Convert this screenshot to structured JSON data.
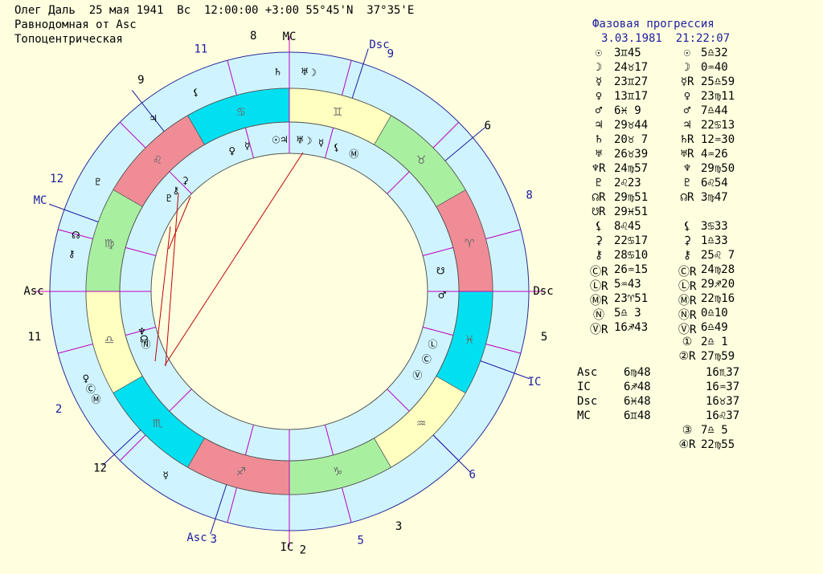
{
  "header": {
    "line1": "Олег Даль  25 мая 1941  Вс  12:00:00 +3:00 55°45'N  37°35'E",
    "line2": "Равнодомная от Asc",
    "line3": "Топоцентрическая"
  },
  "panel": {
    "title": "Фазовая прогрессия",
    "date": "3.03.1981  21:22:07",
    "rows": [
      {
        "s1": "☉",
        "v1": "3♊45",
        "s2": "☉",
        "v2": "5♎32"
      },
      {
        "s1": "☽",
        "v1": "24♉17",
        "s2": "☽",
        "v2": "0♒40"
      },
      {
        "s1": "☿",
        "v1": "23♊27",
        "s2": "☿R",
        "v2": "25♎59"
      },
      {
        "s1": "♀",
        "v1": "13♊17",
        "s2": "♀",
        "v2": "23♍11"
      },
      {
        "s1": "♂",
        "v1": "6♓ 9",
        "s2": "♂",
        "v2": "7♎44"
      },
      {
        "s1": "♃",
        "v1": "29♉44",
        "s2": "♃",
        "v2": "22♋13"
      },
      {
        "s1": "♄",
        "v1": "20♉ 7",
        "s2": "♄R",
        "v2": "12♒30"
      },
      {
        "s1": "♅",
        "v1": "26♉39",
        "s2": "♅R",
        "v2": "4♒26"
      },
      {
        "s1": "♆R",
        "v1": "24♍57",
        "s2": "♆",
        "v2": "29♍50"
      },
      {
        "s1": "♇",
        "v1": "2♌23",
        "s2": "♇",
        "v2": "6♌54"
      },
      {
        "s1": "☊R",
        "v1": "29♍51",
        "s2": "☊R",
        "v2": "3♍47"
      },
      {
        "s1": "☋R",
        "v1": "29♓51",
        "s2": "",
        "v2": ""
      },
      {
        "s1": "⚸",
        "v1": "8♌45",
        "s2": "⚸",
        "v2": "3♋33"
      },
      {
        "s1": "⚳",
        "v1": "22♋17",
        "s2": "⚳",
        "v2": "1♎33"
      },
      {
        "s1": "⚷",
        "v1": "28♋10",
        "s2": "⚷",
        "v2": "25♌ 7"
      },
      {
        "s1": "ⒸR",
        "v1": "26♒15",
        "s2": "ⒸR",
        "v2": "24♍28"
      },
      {
        "s1": "ⓁR",
        "v1": "5♒43",
        "s2": "ⓁR",
        "v2": "29♐20"
      },
      {
        "s1": "ⓂR",
        "v1": "23♈51",
        "s2": "ⓂR",
        "v2": "22♍16"
      },
      {
        "s1": "Ⓝ",
        "v1": "5♎ 3",
        "s2": "ⓃR",
        "v2": "0♎10"
      },
      {
        "s1": "ⓋR",
        "v1": "16♐43",
        "s2": "ⓋR",
        "v2": "6♎49"
      },
      {
        "s1": "",
        "v1": "",
        "s2": "①",
        "v2": "2♎ 1"
      },
      {
        "s1": "",
        "v1": "",
        "s2": "②R",
        "v2": "27♍59"
      }
    ],
    "angles": [
      {
        "label": "Asc",
        "v1": "6♍48",
        "v2": "16♏37"
      },
      {
        "label": "IC",
        "v1": "6♐48",
        "v2": "16♒37"
      },
      {
        "label": "Dsc",
        "v1": "6♓48",
        "v2": "16♉37"
      },
      {
        "label": "MC",
        "v1": "6♊48",
        "v2": "16♌37"
      }
    ],
    "extra": [
      {
        "s2": "③",
        "v2": "7♎ 5"
      },
      {
        "s2": "④R",
        "v2": "22♍55"
      }
    ]
  },
  "chart_labels": {
    "outer_houses": [
      {
        "n": "8",
        "a": 98
      },
      {
        "n": "9",
        "a": 67
      },
      {
        "n": "6",
        "a": 40
      },
      {
        "n": "8",
        "a": 22
      },
      {
        "n": "5",
        "a": -10
      },
      {
        "n": "6",
        "a": -45
      },
      {
        "n": "3",
        "a": -65
      },
      {
        "n": "5",
        "a": -74
      },
      {
        "n": "2",
        "a": -87
      },
      {
        "n": "3",
        "a": -107
      },
      {
        "n": "12",
        "a": -137
      },
      {
        "n": "2",
        "a": -153
      },
      {
        "n": "11",
        "a": 190
      },
      {
        "n": "12",
        "a": 154
      },
      {
        "n": "9",
        "a": 125
      },
      {
        "n": "11",
        "a": 110
      }
    ],
    "angle_labels": [
      {
        "t": "MC",
        "a": 90,
        "color": "#000"
      },
      {
        "t": "Dsc",
        "a": 0,
        "color": "#000"
      },
      {
        "t": "IC",
        "a": -90,
        "color": "#000"
      },
      {
        "t": "Asc",
        "a": 180,
        "color": "#000"
      },
      {
        "t": "Dsc",
        "a": 72,
        "color": "#1a1aa0"
      },
      {
        "t": "IC",
        "a": -20,
        "color": "#1a1aa0"
      },
      {
        "t": "Asc",
        "a": -108,
        "color": "#1a1aa0"
      },
      {
        "t": "MC",
        "a": 160,
        "color": "#1a1aa0"
      }
    ],
    "signs": [
      "♈",
      "♉",
      "♊",
      "♋",
      "♌",
      "♍",
      "♎",
      "♏",
      "♐",
      "♑",
      "♒",
      "♓"
    ],
    "sign_colors": [
      "#f08c96",
      "#a8f0a0",
      "#ffffc0",
      "#00e0f0"
    ]
  }
}
